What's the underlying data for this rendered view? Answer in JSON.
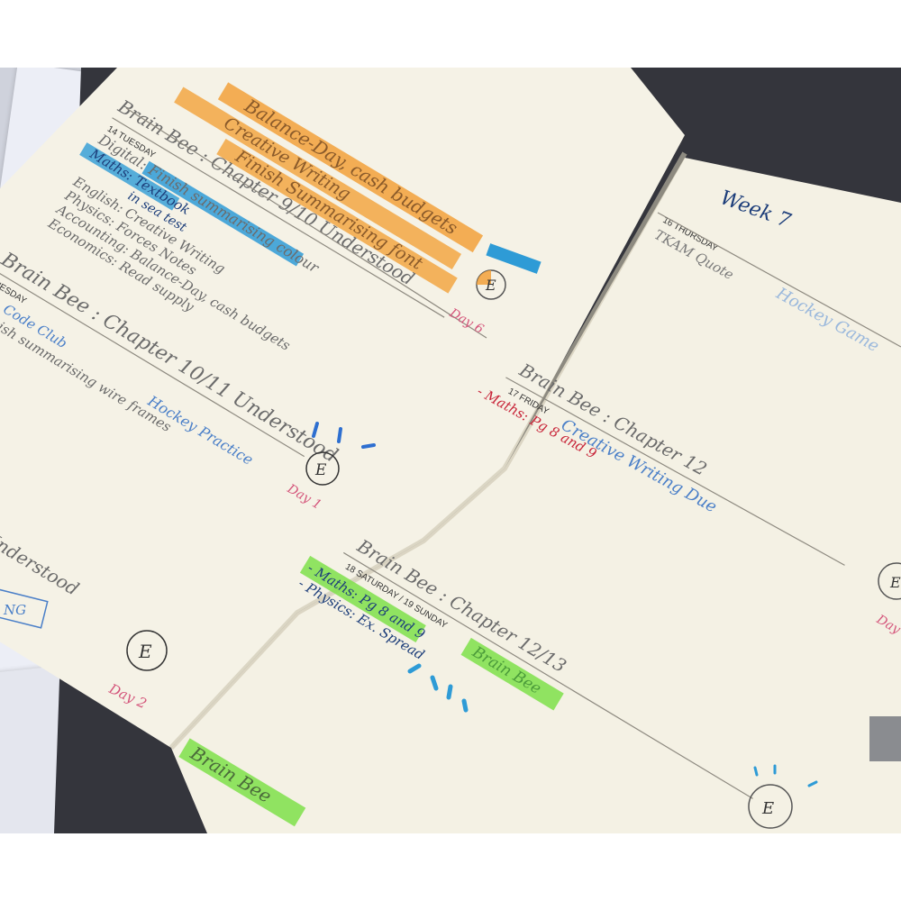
{
  "left_page": {
    "entry1": {
      "header": "Brain Bee : Chapter 9/10 Understood",
      "date_label": "14 TUESDAY",
      "lines": [
        "Digital: Finish summarising colour",
        "Maths: Textbook",
        "English: Creative Writing",
        "Physics: Forces Notes",
        "Accounting: Balance-Day, cash budgets",
        "Economics: Read supply"
      ],
      "highlight_note": "in sea test",
      "day": "Day 6",
      "circle_letter": "E"
    },
    "top_strikes": [
      "Balance-Day, cash budgets",
      "Creative Writing",
      "Finish Summarising font",
      "Read supply"
    ],
    "entry2": {
      "header": "Brain Bee : Chapter 10/11 Understood",
      "date_label": "TUESDAY",
      "lines": [
        "Code Club",
        "Finish summarising wire frames",
        "Hockey Practice"
      ],
      "day": "Day 1",
      "circle_letter": "E"
    },
    "entry3": {
      "header": "Understood",
      "boxed": "NG",
      "day": "Day 2",
      "circle_letter": "E"
    }
  },
  "right_page": {
    "week": "Week 7",
    "thursday": {
      "date_label": "16 THURSDAY",
      "lines": [
        "TKAM Quote",
        "Hockey Game"
      ]
    },
    "friday": {
      "header": "Brain Bee : Chapter 12",
      "date_label": "17 FRIDAY",
      "lines": [
        "- Maths: Pg 8 and 9",
        "Creative Writing Due"
      ]
    },
    "weekend": {
      "header": "Brain Bee : Chapter 12/13",
      "date_label": "18 SATURDAY / 19 SUNDAY",
      "lines": [
        "- Maths: Pg 8 and 9",
        "- Physics: Ex. Spread",
        "Brain Bee"
      ],
      "circle_letter": "E"
    },
    "bottom_note": "Brain Bee",
    "edge_day": "Day",
    "edge_circle": "E"
  },
  "colors": {
    "orange_highlight": "#f2a13a",
    "blue_highlight": "#2e9bd6",
    "green_highlight": "#7ee04a",
    "ink_gray": "#6b6b6b",
    "ink_pink": "#d4547a",
    "ink_blue": "#4a7fc8",
    "ink_red": "#c8263a"
  }
}
